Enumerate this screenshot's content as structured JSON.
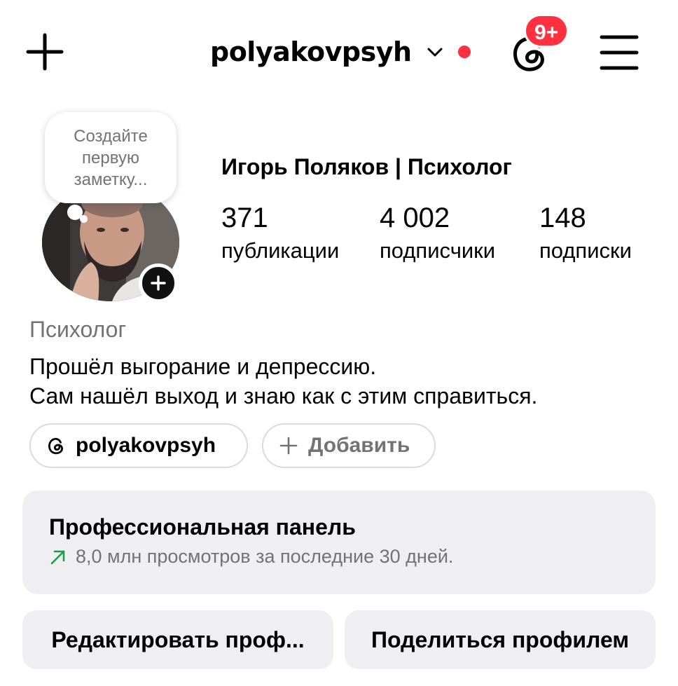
{
  "header": {
    "username": "polyakovpsyh",
    "notification_badge": "9+",
    "accent_color": "#ff3040",
    "icons": [
      "plus-icon",
      "chevron-down-icon",
      "threads-icon",
      "menu-icon"
    ]
  },
  "note": {
    "text": "Создайте первую заметку..."
  },
  "profile": {
    "full_name": "Игорь Поляков | Психолог",
    "stats": [
      {
        "value": "371",
        "label": "публикации"
      },
      {
        "value": "4 002",
        "label": "подписчики"
      },
      {
        "value": "148",
        "label": "подписки"
      }
    ],
    "category": "Психолог",
    "bio": [
      "Прошёл выгорание и депрессию.",
      "Сам нашёл выход и знаю как с этим справиться."
    ]
  },
  "links": {
    "threads_handle": "polyakovpsyh",
    "add_label": "Добавить"
  },
  "dashboard": {
    "title": "Профессиональная панель",
    "subtitle": "8,0 млн просмотров за последние 30 дней.",
    "trend_color": "#1a9e4b"
  },
  "actions": {
    "edit_label": "Редактировать проф...",
    "share_label": "Поделиться профилем"
  }
}
